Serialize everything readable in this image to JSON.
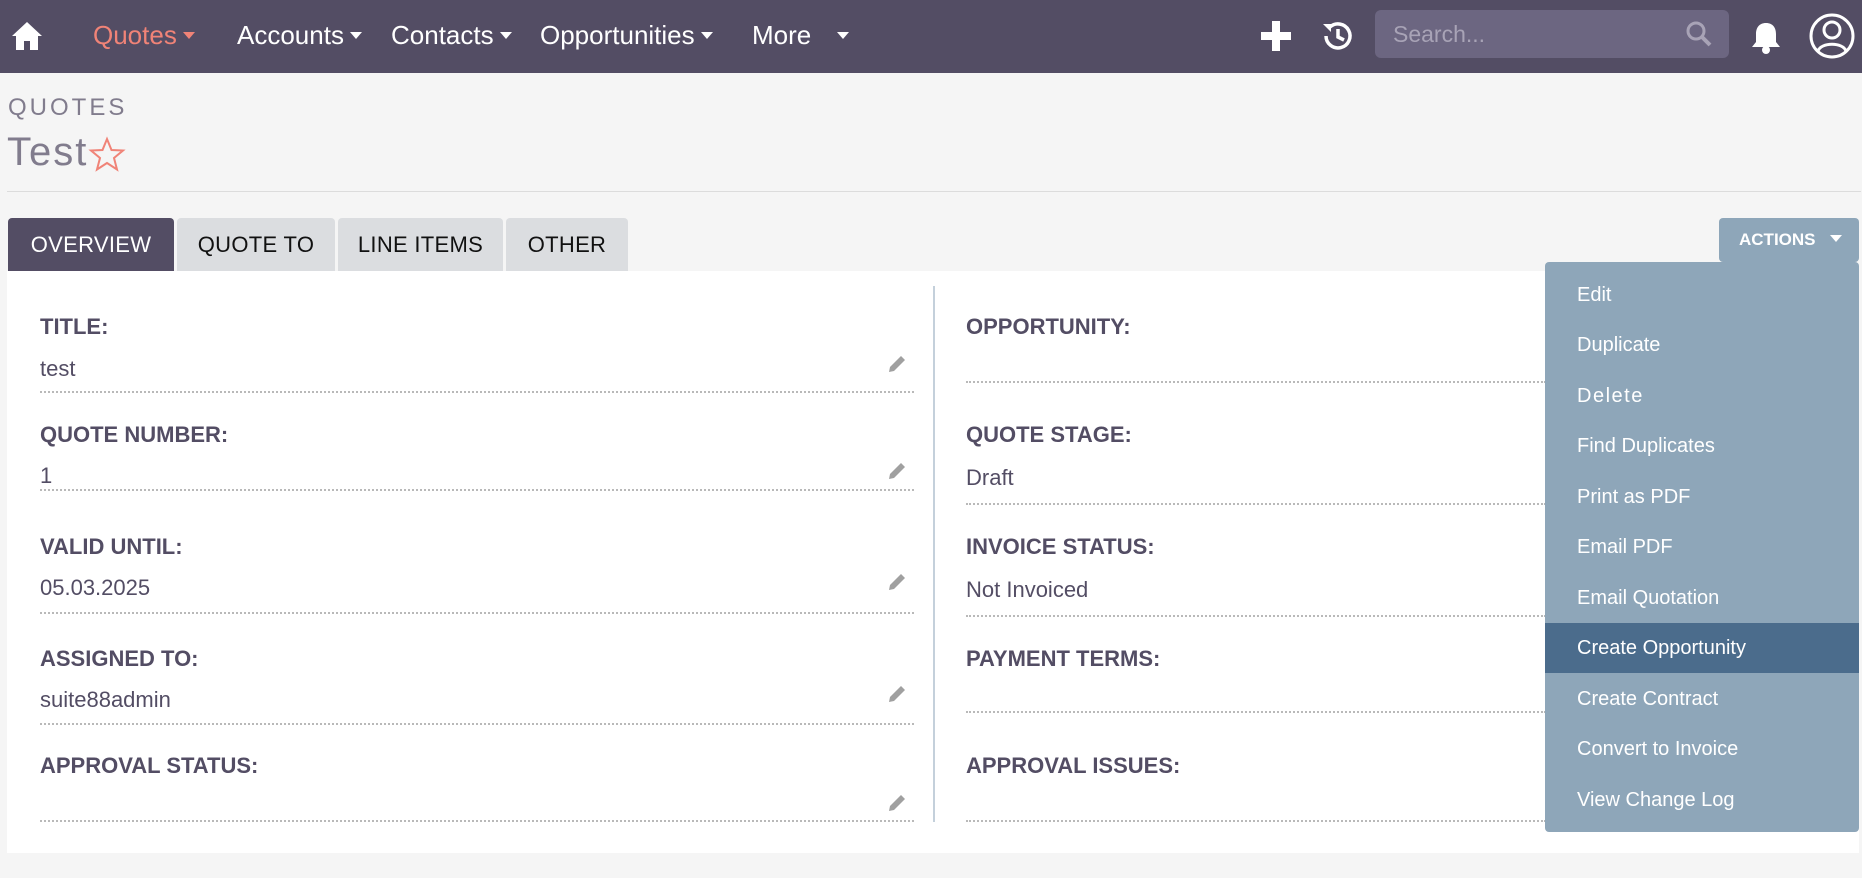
{
  "nav": {
    "items": [
      {
        "label": "Quotes",
        "active": true
      },
      {
        "label": "Accounts"
      },
      {
        "label": "Contacts"
      },
      {
        "label": "Opportunities"
      },
      {
        "label": "More"
      }
    ],
    "search_placeholder": "Search...",
    "icons": [
      "home-icon",
      "plus-icon",
      "history-icon",
      "search-icon",
      "bell-icon",
      "user-icon"
    ]
  },
  "header": {
    "module": "QUOTES",
    "title": "Test"
  },
  "tabs": [
    {
      "label": "OVERVIEW",
      "active": true
    },
    {
      "label": "QUOTE TO"
    },
    {
      "label": "LINE ITEMS"
    },
    {
      "label": "OTHER"
    }
  ],
  "actions": {
    "label": "ACTIONS",
    "menu": [
      {
        "label": "Edit"
      },
      {
        "label": "Duplicate"
      },
      {
        "label": "Delete"
      },
      {
        "label": "Find Duplicates"
      },
      {
        "label": "Print as PDF"
      },
      {
        "label": "Email PDF"
      },
      {
        "label": "Email Quotation"
      },
      {
        "label": "Create Opportunity",
        "highlighted": true
      },
      {
        "label": "Create Contract"
      },
      {
        "label": "Convert to Invoice"
      },
      {
        "label": "View Change Log"
      }
    ]
  },
  "fields_left": [
    {
      "label": "TITLE:",
      "value": "test"
    },
    {
      "label": "QUOTE NUMBER:",
      "value": "1"
    },
    {
      "label": "VALID UNTIL:",
      "value": "05.03.2025"
    },
    {
      "label": "ASSIGNED TO:",
      "value": "suite88admin"
    },
    {
      "label": "APPROVAL STATUS:",
      "value": ""
    }
  ],
  "fields_right": [
    {
      "label": "OPPORTUNITY:",
      "value": ""
    },
    {
      "label": "QUOTE STAGE:",
      "value": "Draft"
    },
    {
      "label": "INVOICE STATUS:",
      "value": "Not Invoiced"
    },
    {
      "label": "PAYMENT TERMS:",
      "value": ""
    },
    {
      "label": "APPROVAL ISSUES:",
      "value": ""
    }
  ],
  "colors": {
    "nav_bg": "#534d64",
    "accent": "#f08377",
    "actions_bg": "#8ea6b9",
    "menu_highlight": "#4b6c8c"
  }
}
